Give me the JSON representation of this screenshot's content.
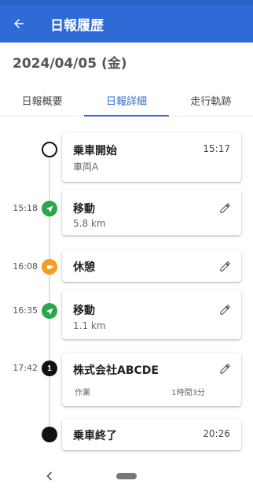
{
  "appbar": {
    "title": "日報履歴",
    "back_icon": "arrow-left-icon"
  },
  "date_header": "2024/04/05 (金)",
  "tabs": [
    {
      "label": "日報概要",
      "active": false
    },
    {
      "label": "日報詳細",
      "active": true
    },
    {
      "label": "走行軌跡",
      "active": false
    }
  ],
  "timeline": [
    {
      "time": "",
      "marker": "hollow-circle",
      "title": "乗車開始",
      "subtitle": "車両A",
      "right_time": "15:17",
      "editable": false
    },
    {
      "time": "15:18",
      "marker": "navigation-arrow",
      "title": "移動",
      "subtitle": "5.8 km",
      "editable": true
    },
    {
      "time": "16:08",
      "marker": "rest-icon",
      "title": "休憩",
      "subtitle": "",
      "editable": true
    },
    {
      "time": "16:35",
      "marker": "navigation-arrow",
      "title": "移動",
      "subtitle": "1.1 km",
      "editable": true
    },
    {
      "time": "17:42",
      "marker": "numbered",
      "marker_label": "1",
      "title": "株式会社ABCDE",
      "work_label": "作業",
      "duration": "1時間3分",
      "editable": true
    },
    {
      "time": "",
      "marker": "filled-circle",
      "title": "乗車終了",
      "right_time": "20:26",
      "editable": false
    }
  ],
  "colors": {
    "primary": "#2e6bd6",
    "move_green": "#2aa64c",
    "rest_orange": "#f39c1f"
  }
}
